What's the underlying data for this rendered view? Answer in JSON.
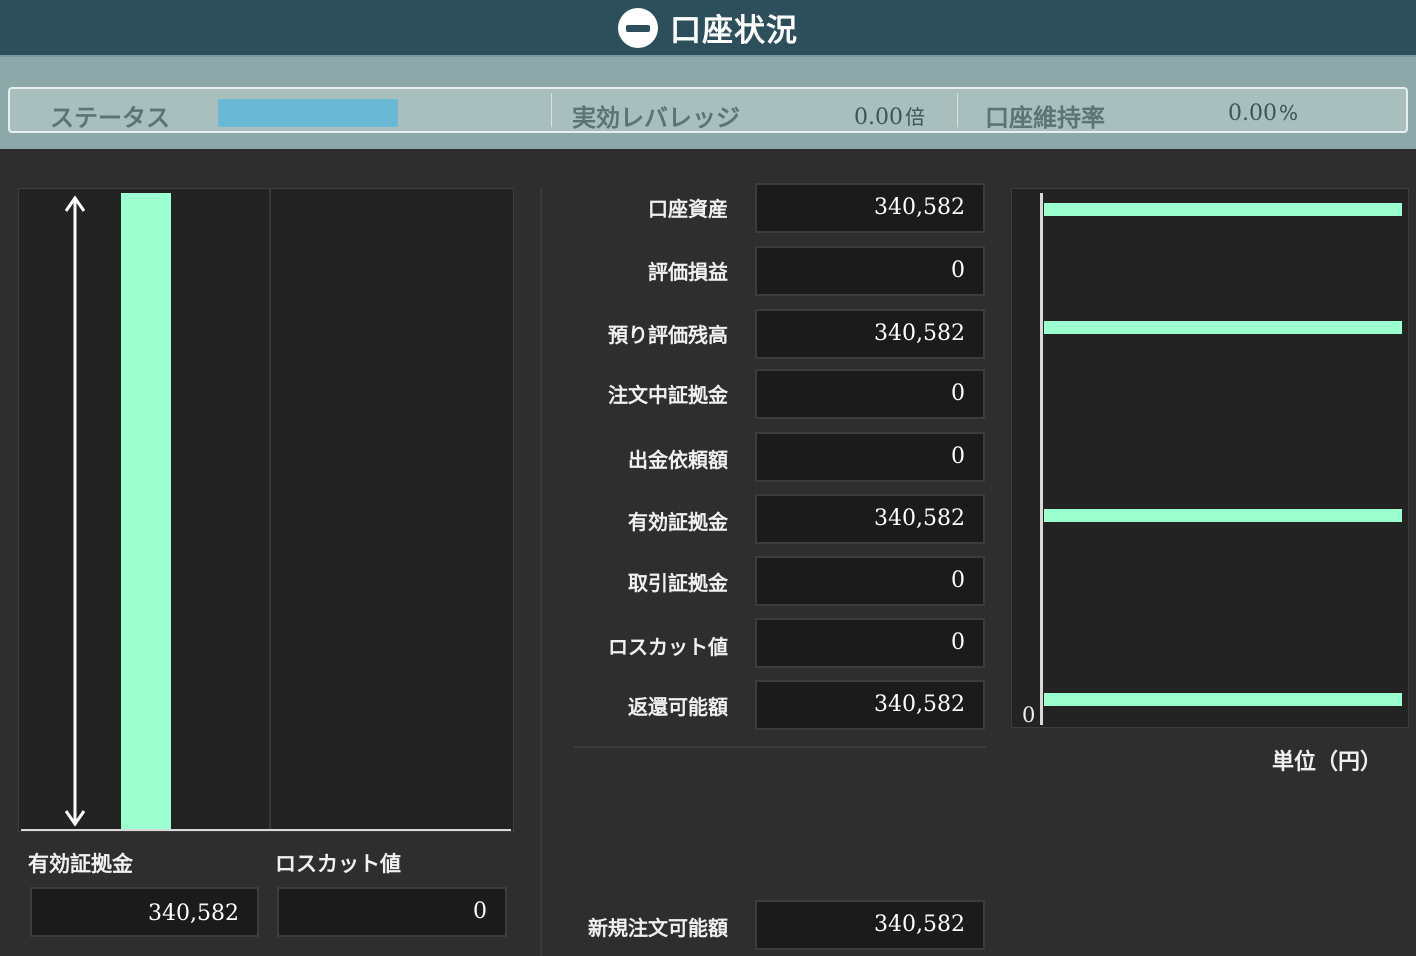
{
  "title": "口座状況",
  "status_bar": {
    "status_label": "ステータス",
    "leverage_label": "実効レバレッジ",
    "leverage_value": "0.00",
    "leverage_unit": "倍",
    "maintenance_label": "口座維持率",
    "maintenance_value": "0.00",
    "maintenance_unit": "%",
    "status_color": "#68b8d6"
  },
  "left_panel": {
    "effective_margin_label": "有効証拠金",
    "effective_margin_value": "340,582",
    "losscut_label": "ロスカット値",
    "losscut_value": "0"
  },
  "rows": [
    {
      "label": "口座資産",
      "value": "340,582"
    },
    {
      "label": "評価損益",
      "value": "0"
    },
    {
      "label": "預り評価残高",
      "value": "340,582"
    },
    {
      "label": "注文中証拠金",
      "value": "0"
    },
    {
      "label": "出金依頼額",
      "value": "0"
    },
    {
      "label": "有効証拠金",
      "value": "340,582"
    },
    {
      "label": "取引証拠金",
      "value": "0"
    },
    {
      "label": "ロスカット値",
      "value": "0"
    },
    {
      "label": "返還可能額",
      "value": "340,582"
    }
  ],
  "new_order": {
    "label": "新規注文可能額",
    "value": "340,582"
  },
  "right_chart": {
    "zero_label": "0",
    "unit_label": "単位（円）"
  },
  "colors": {
    "accent": "#9cffcf",
    "header": "#2d4f5b",
    "status_band": "#8ca8a8"
  }
}
